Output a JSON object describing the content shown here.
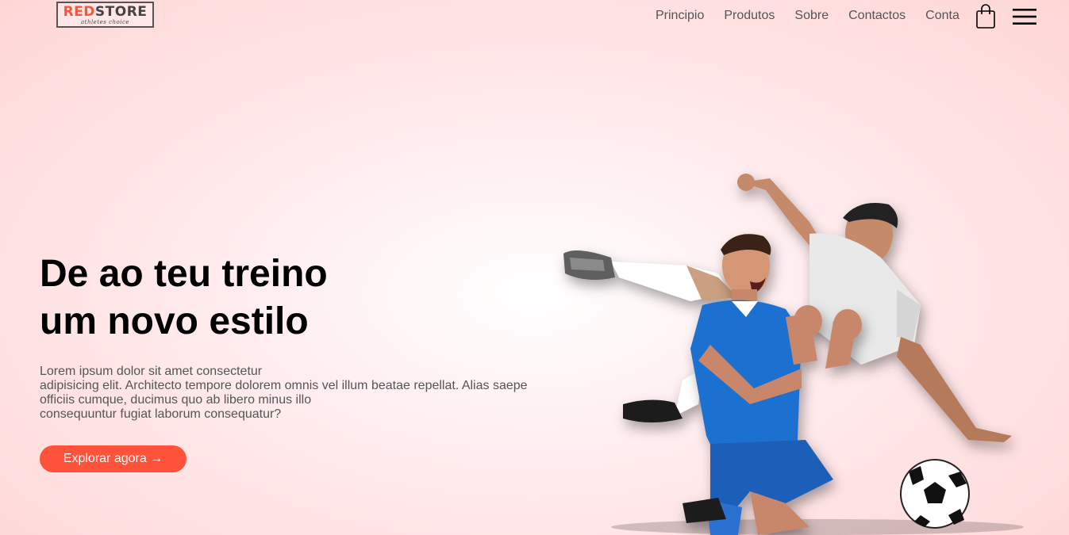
{
  "brand": {
    "name_part1": "RED",
    "name_part2": "STORE",
    "tagline": "athletes choice"
  },
  "nav": {
    "items": [
      {
        "label": "Principio"
      },
      {
        "label": "Produtos"
      },
      {
        "label": "Sobre"
      },
      {
        "label": "Contactos"
      },
      {
        "label": "Conta"
      }
    ]
  },
  "icons": {
    "cart": "shopping-bag-icon",
    "menu": "hamburger-menu-icon"
  },
  "hero": {
    "title_line1": "De ao teu treino",
    "title_line2": "um novo estilo",
    "text_lines": [
      "Lorem ipsum dolor sit amet consectetur",
      "adipisicing elit. Architecto tempore dolorem omnis vel illum beatae repellat. Alias saepe",
      "officiis cumque, ducimus quo ab libero minus illo",
      "consequuntur fugiat laborum consequatur?"
    ],
    "cta_label": "Explorar agora →",
    "image": "football-players-photo"
  },
  "colors": {
    "accent": "#ff523b",
    "background": "#ffd6d6",
    "text_muted": "#555555"
  }
}
